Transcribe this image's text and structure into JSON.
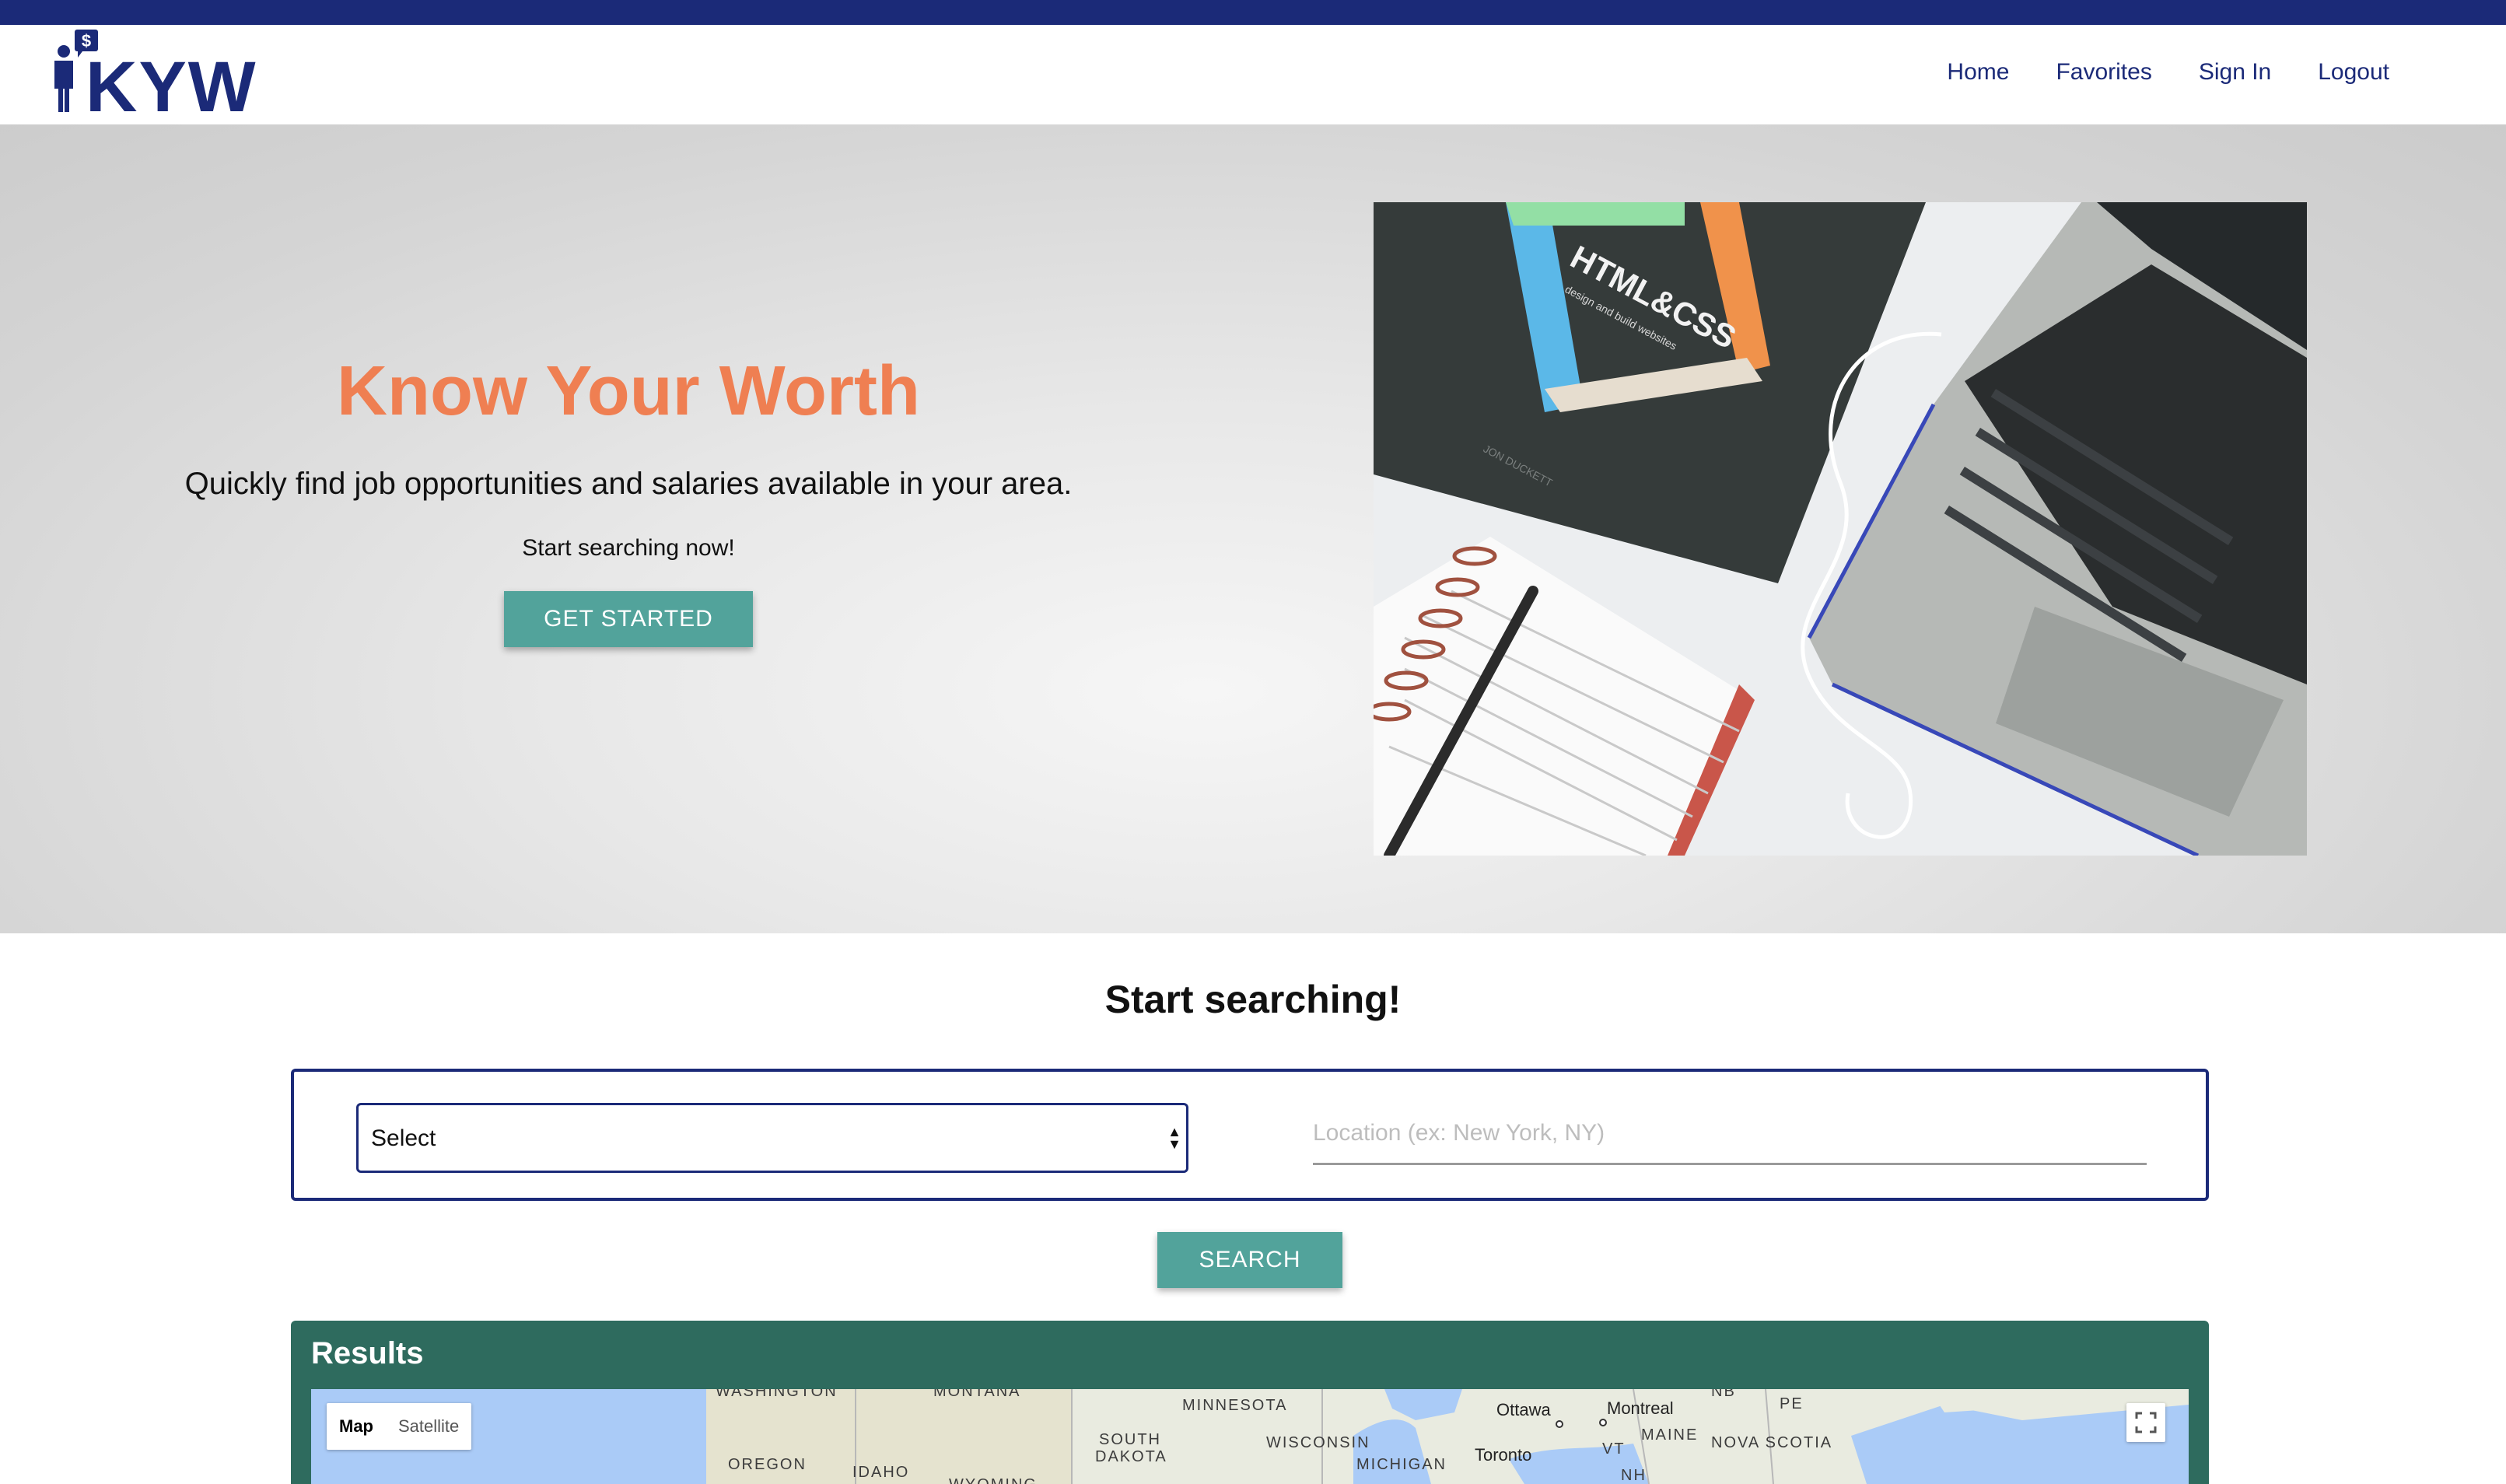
{
  "brand": {
    "logo_text": "KYW",
    "logo_dollar": "$",
    "color_primary": "#1b2a78",
    "color_accent": "#ef7f52",
    "color_button": "#52a39b",
    "color_results": "#2e6b5e"
  },
  "nav": {
    "home": "Home",
    "favorites": "Favorites",
    "sign_in": "Sign In",
    "logout": "Logout"
  },
  "hero": {
    "title": "Know Your Worth",
    "subtitle": "Quickly find job opportunities and salaries available in your area.",
    "prompt": "Start searching now!",
    "cta": "GET STARTED",
    "book_title": "HTML&CSS",
    "book_subtitle": "design and build websites",
    "book_author": "JON DUCKETT"
  },
  "search": {
    "heading": "Start searching!",
    "select_value": "Select",
    "location_placeholder": "Location (ex: New York, NY)",
    "button": "SEARCH"
  },
  "results": {
    "title": "Results",
    "map": {
      "type_map": "Map",
      "type_satellite": "Satellite",
      "labels": {
        "washington": "WASHINGTON",
        "montana": "MONTANA",
        "minnesota": "MINNESOTA",
        "oregon": "OREGON",
        "idaho": "IDAHO",
        "south_dakota": "SOUTH DAKOTA",
        "wisconsin": "WISCONSIN",
        "michigan": "MICHIGAN",
        "wyoming": "WYOMING",
        "ottawa": "Ottawa",
        "montreal": "Montreal",
        "toronto": "Toronto",
        "maine": "MAINE",
        "vt": "VT",
        "nh": "NH",
        "nb": "NB",
        "pe": "PE",
        "nova_scotia": "NOVA SCOTIA"
      }
    }
  }
}
